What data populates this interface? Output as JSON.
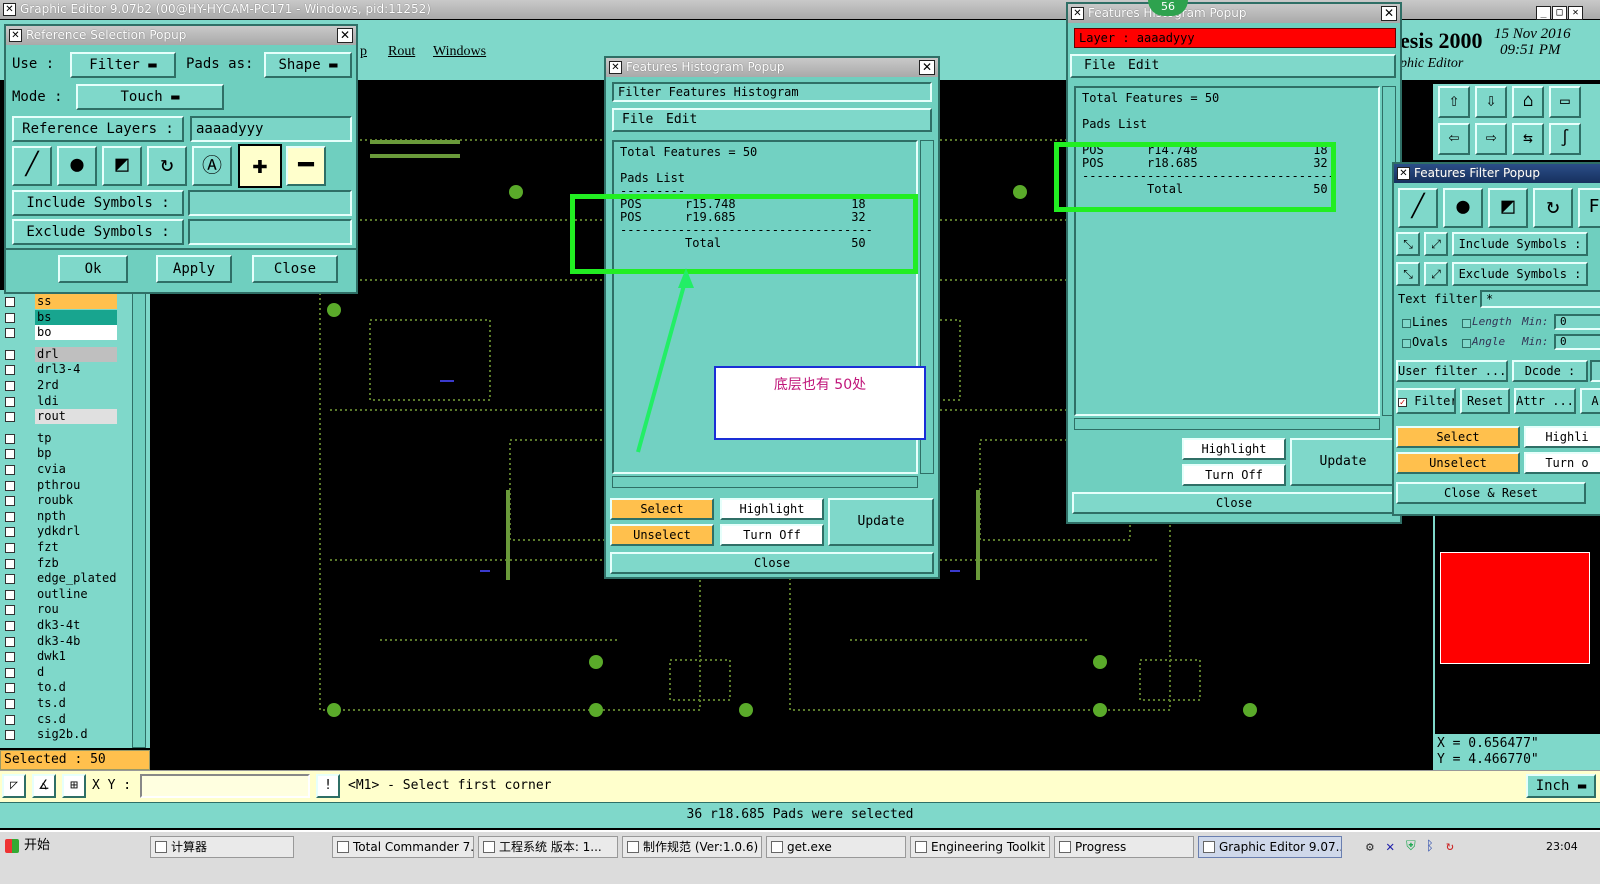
{
  "main_window": {
    "title": "Graphic Editor 9.07b2 (00@HY-HYCAM-PC171 - Windows, pid:11252)"
  },
  "main_menu": {
    "items": [
      "p",
      "Rout",
      "Windows"
    ]
  },
  "brand": {
    "name": "esis 2000",
    "sub": "phic Editor",
    "date": "15 Nov 2016",
    "time": "09:51 PM"
  },
  "reference_popup": {
    "title": "Reference Selection Popup",
    "use_label": "Use   :",
    "use_value": "Filter",
    "pads_label": "Pads as:",
    "pads_value": "Shape",
    "mode_label": "Mode  :",
    "mode_value": "Touch",
    "ref_layers_label": "Reference Layers :",
    "ref_layers_value": "aaaadyyy",
    "include_label": "Include Symbols :",
    "exclude_label": "Exclude Symbols :",
    "ok": "Ok",
    "apply": "Apply",
    "close": "Close"
  },
  "layers": [
    {
      "name": "ss",
      "color": "#ffc04d"
    },
    {
      "name": "bs",
      "color": "#18a58f"
    },
    {
      "name": "bo",
      "color": "#ffffff"
    },
    {
      "name": "drl",
      "color": "#bfbfbf"
    },
    {
      "name": "drl3-4",
      "color": "#7fd8ca"
    },
    {
      "name": "2rd",
      "color": "#7fd8ca"
    },
    {
      "name": "ldi",
      "color": "#7fd8ca"
    },
    {
      "name": "rout",
      "color": "#e0e0e0"
    },
    {
      "name": "tp",
      "color": "#7fd8ca"
    },
    {
      "name": "bp",
      "color": "#7fd8ca"
    },
    {
      "name": "cvia",
      "color": "#7fd8ca"
    },
    {
      "name": "pthrou",
      "color": "#7fd8ca"
    },
    {
      "name": "roubk",
      "color": "#7fd8ca"
    },
    {
      "name": "npth",
      "color": "#7fd8ca"
    },
    {
      "name": "ydkdrl",
      "color": "#7fd8ca"
    },
    {
      "name": "fzt",
      "color": "#7fd8ca"
    },
    {
      "name": "fzb",
      "color": "#7fd8ca"
    },
    {
      "name": "edge_plated",
      "color": "#7fd8ca"
    },
    {
      "name": "outline",
      "color": "#7fd8ca"
    },
    {
      "name": "rou",
      "color": "#7fd8ca"
    },
    {
      "name": "dk3-4t",
      "color": "#7fd8ca"
    },
    {
      "name": "dk3-4b",
      "color": "#7fd8ca"
    },
    {
      "name": "dwk1",
      "color": "#7fd8ca"
    },
    {
      "name": "d",
      "color": "#7fd8ca"
    },
    {
      "name": "to.d",
      "color": "#7fd8ca"
    },
    {
      "name": "ts.d",
      "color": "#7fd8ca"
    },
    {
      "name": "cs.d",
      "color": "#7fd8ca"
    },
    {
      "name": "sig2b.d",
      "color": "#7fd8ca"
    }
  ],
  "selected_label": "Selected : 50",
  "histogram_center": {
    "title": "Features Histogram Popup",
    "header": "Filter Features Histogram",
    "menu": [
      "File",
      "Edit"
    ],
    "content": "Total Features = 50\n\nPads List\n---------\nPOS      r15.748                18\nPOS      r19.685                32\n-----------------------------------\n         Total                  50",
    "select": "Select",
    "highlight": "Highlight",
    "unselect": "Unselect",
    "turnoff": "Turn Off",
    "update": "Update",
    "close": "Close"
  },
  "annotation": {
    "text": "底层也有 50处"
  },
  "histogram_right": {
    "title": "Features Histogram Popup",
    "layer_label": "Layer :  aaaadyyy",
    "menu": [
      "File",
      "Edit"
    ],
    "content": "Total Features = 50\n\nPads List\n\nPOS      r14.748                18\nPOS      r18.685                32\n-----------------------------------\n         Total                  50",
    "highlight": "Highlight",
    "turnoff": "Turn Off",
    "update": "Update",
    "close": "Close",
    "badge": "56"
  },
  "filter_popup": {
    "title": "Features Filter Popup",
    "include": "Include Symbols :",
    "exclude": "Exclude Symbols :",
    "text_filter": "Text filter",
    "text_value": "*",
    "lines": "Lines",
    "ovals": "Ovals",
    "length": "Length",
    "angle": "Angle",
    "min": "Min:",
    "min_val": "0",
    "user_filter": "User filter ...",
    "dcode": "Dcode :",
    "filter": "Filter",
    "reset": "Reset",
    "attr": "Attr ...",
    "a": "A",
    "select": "Select",
    "highlight": "Highli",
    "unselect": "Unselect",
    "turn": "Turn o",
    "close_reset": "Close & Reset"
  },
  "coords": {
    "x": "X = 0.656477\"",
    "y": "Y = 4.466770\""
  },
  "bottom": {
    "xy_label": "X Y :",
    "prompt": "<M1> - Select first corner",
    "units": "Inch",
    "status": "36 r18.685 Pads were selected"
  },
  "taskbar": {
    "start": "开始",
    "items": [
      "计算器",
      "Total Commander 7.0...",
      "工程系统  版本: 1...",
      "制作规范 (Ver:1.0.6)",
      "get.exe",
      "Engineering Toolkit 9....",
      "Progress",
      "Graphic Editor 9.07..."
    ],
    "clock": "23:04"
  },
  "colors": {
    "teal": "#6fcfbf",
    "highlight": "#22ee22",
    "red": "#ff0000",
    "orange": "#ffc04d"
  }
}
